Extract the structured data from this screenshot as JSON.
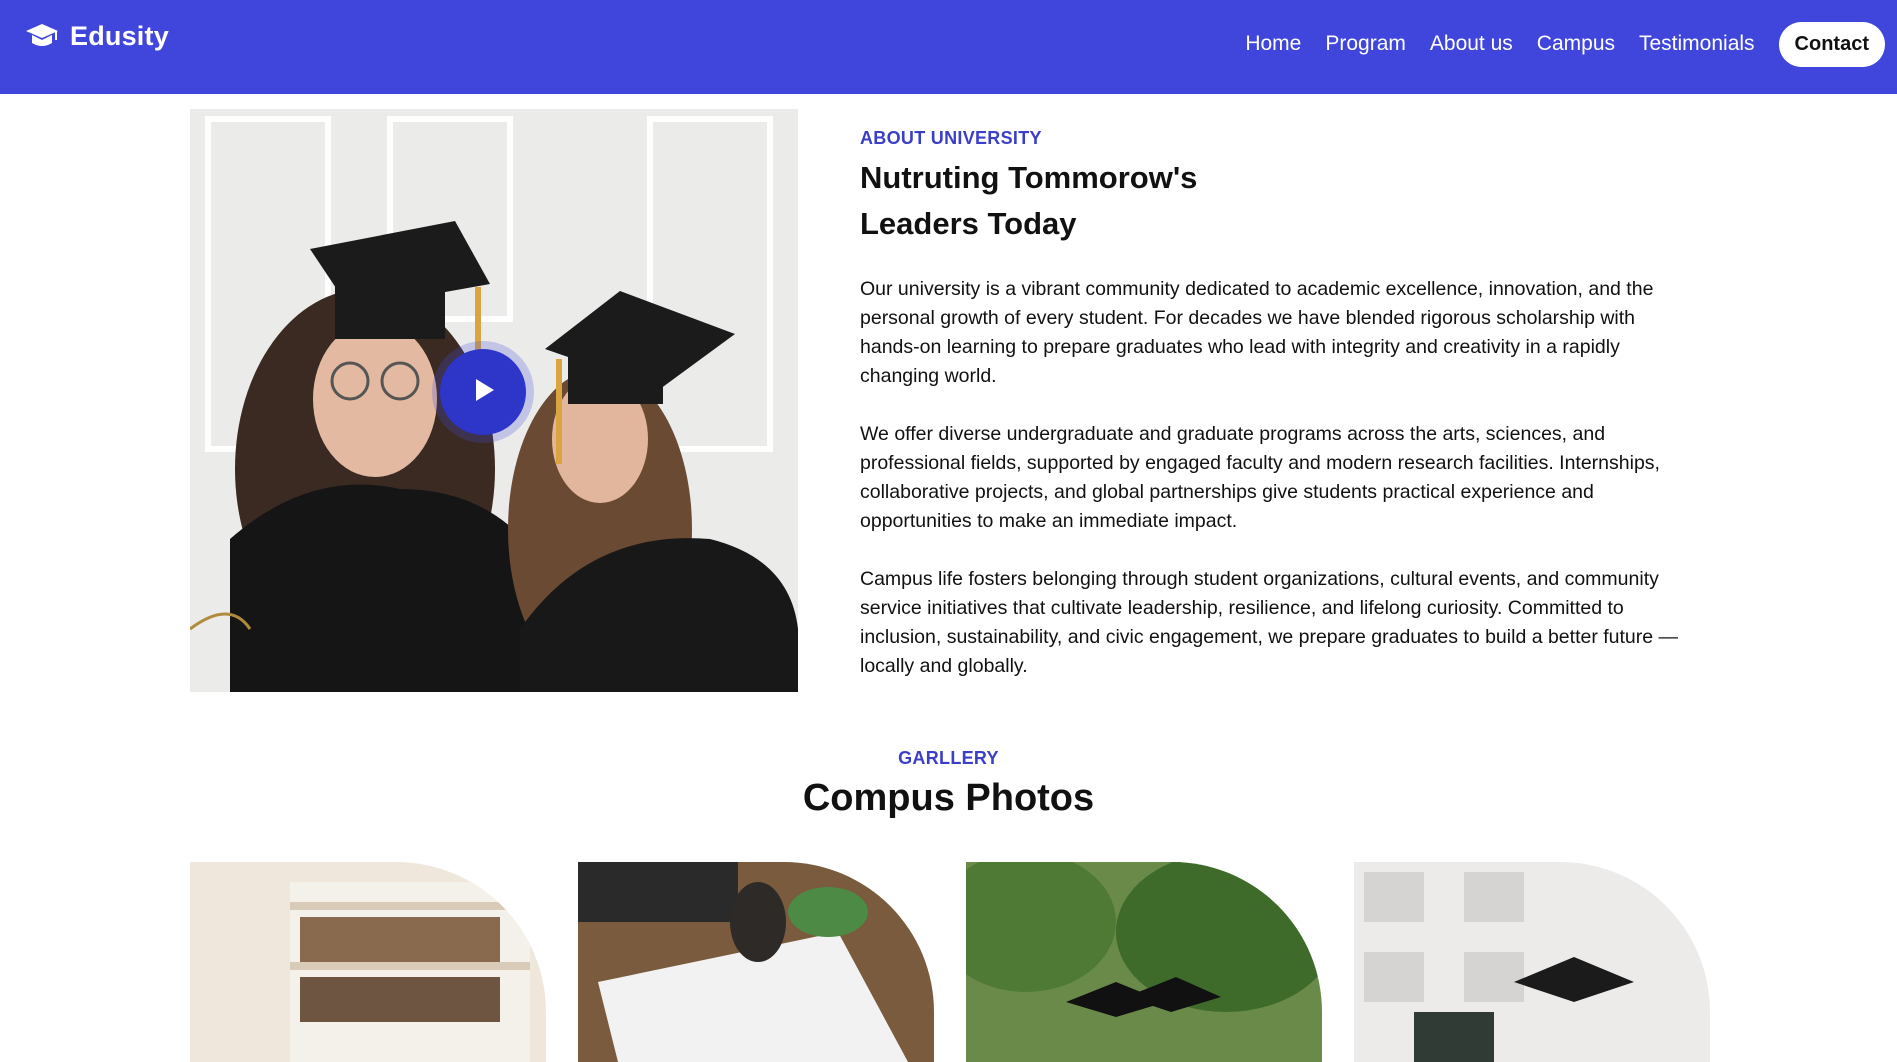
{
  "navbar": {
    "brand": "Edusity",
    "links": [
      "Home",
      "Program",
      "About us",
      "Campus",
      "Testimonials"
    ],
    "contact_label": "Contact",
    "accent": "#4046dc"
  },
  "about": {
    "eyebrow": "ABOUT UNIVERSITY",
    "title_line1": "Nutruting Tommorow's",
    "title_line2": "Leaders Today",
    "paragraphs": [
      "Our university is a vibrant community dedicated to academic excellence, innovation, and the personal growth of every student. For decades we have blended rigorous scholarship with hands-on learning to prepare graduates who lead with integrity and creativity in a rapidly changing world.",
      "We offer diverse undergraduate and graduate programs across the arts, sciences, and professional fields, supported by engaged faculty and modern research facilities. Internships, collaborative projects, and global partnerships give students practical experience and opportunities to make an immediate impact.",
      "Campus life fosters belonging through student organizations, cultural events, and community service initiatives that cultivate leadership, resilience, and lifelong curiosity. Committed to inclusion, sustainability, and civic engagement, we prepare graduates to build a better future — locally and globally."
    ]
  },
  "gallery": {
    "eyebrow": "GARLLERY",
    "title": "Compus Photos"
  },
  "icons": {
    "logo": "graduation-cap-icon",
    "play": "play-icon"
  },
  "colors": {
    "accent": "#3b3fc8",
    "play": "#2e35c9"
  }
}
